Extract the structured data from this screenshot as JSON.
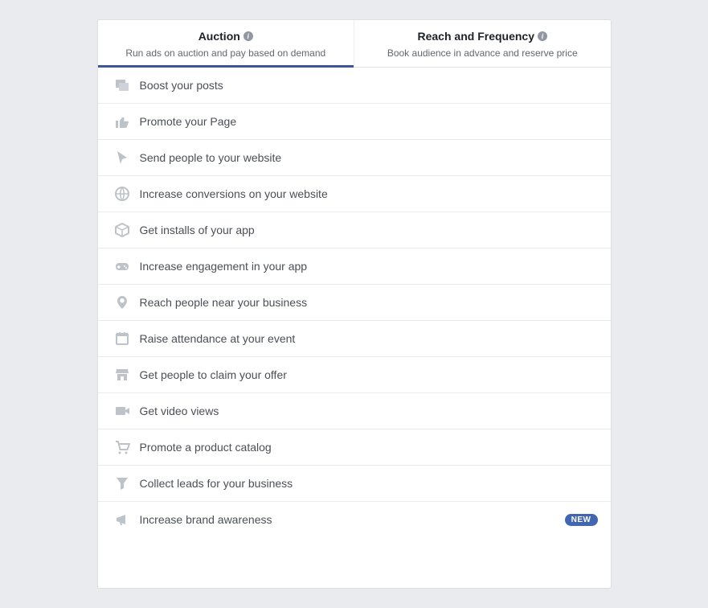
{
  "tabs": [
    {
      "title": "Auction",
      "subtitle": "Run ads on auction and pay based on demand",
      "active": true
    },
    {
      "title": "Reach and Frequency",
      "subtitle": "Book audience in advance and reserve price",
      "active": false
    }
  ],
  "objectives": [
    {
      "icon": "boost",
      "label": "Boost your posts"
    },
    {
      "icon": "like",
      "label": "Promote your Page"
    },
    {
      "icon": "cursor",
      "label": "Send people to your website"
    },
    {
      "icon": "globe",
      "label": "Increase conversions on your website"
    },
    {
      "icon": "box",
      "label": "Get installs of your app"
    },
    {
      "icon": "gamepad",
      "label": "Increase engagement in your app"
    },
    {
      "icon": "pin",
      "label": "Reach people near your business"
    },
    {
      "icon": "calendar",
      "label": "Raise attendance at your event"
    },
    {
      "icon": "store",
      "label": "Get people to claim your offer"
    },
    {
      "icon": "video",
      "label": "Get video views"
    },
    {
      "icon": "cart",
      "label": "Promote a product catalog"
    },
    {
      "icon": "funnel",
      "label": "Collect leads for your business"
    },
    {
      "icon": "megaphone",
      "label": "Increase brand awareness",
      "badge": "NEW"
    }
  ]
}
